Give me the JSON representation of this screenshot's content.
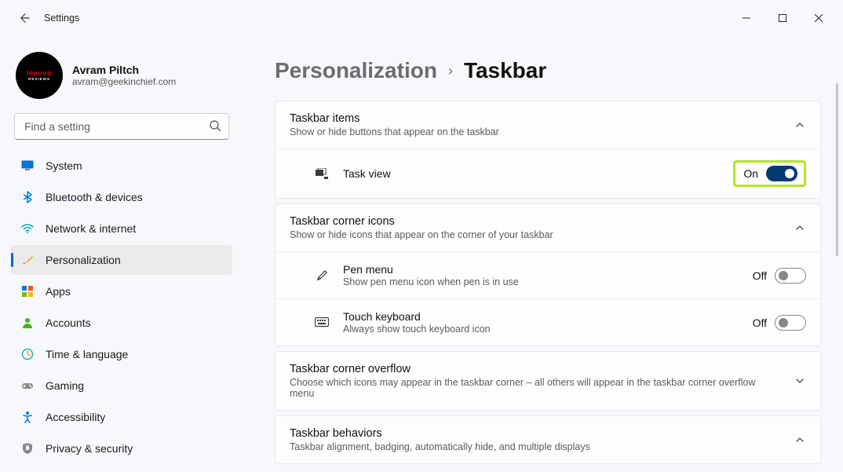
{
  "window": {
    "title": "Settings"
  },
  "user": {
    "name": "Avram Piltch",
    "email": "avram@geekinchief.com",
    "avatar_brand": "lenovo",
    "avatar_sub": "REVIEWS"
  },
  "search": {
    "placeholder": "Find a setting"
  },
  "nav": {
    "items": [
      {
        "label": "System"
      },
      {
        "label": "Bluetooth & devices"
      },
      {
        "label": "Network & internet"
      },
      {
        "label": "Personalization"
      },
      {
        "label": "Apps"
      },
      {
        "label": "Accounts"
      },
      {
        "label": "Time & language"
      },
      {
        "label": "Gaming"
      },
      {
        "label": "Accessibility"
      },
      {
        "label": "Privacy & security"
      }
    ],
    "active_index": 3
  },
  "breadcrumb": {
    "parent": "Personalization",
    "current": "Taskbar"
  },
  "sections": {
    "items": {
      "title": "Taskbar items",
      "sub": "Show or hide buttons that appear on the taskbar",
      "rows": [
        {
          "title": "Task view",
          "state_label": "On",
          "on": true
        }
      ]
    },
    "corner_icons": {
      "title": "Taskbar corner icons",
      "sub": "Show or hide icons that appear on the corner of your taskbar",
      "rows": [
        {
          "title": "Pen menu",
          "sub": "Show pen menu icon when pen is in use",
          "state_label": "Off",
          "on": false
        },
        {
          "title": "Touch keyboard",
          "sub": "Always show touch keyboard icon",
          "state_label": "Off",
          "on": false
        }
      ]
    },
    "overflow": {
      "title": "Taskbar corner overflow",
      "sub": "Choose which icons may appear in the taskbar corner – all others will appear in the taskbar corner overflow menu"
    },
    "behaviors": {
      "title": "Taskbar behaviors",
      "sub": "Taskbar alignment, badging, automatically hide, and multiple displays"
    }
  }
}
